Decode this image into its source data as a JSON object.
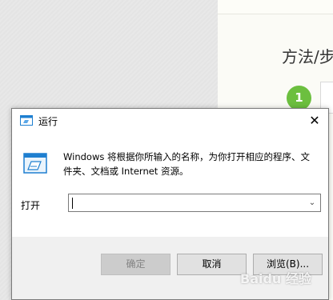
{
  "background_page": {
    "heading": "方法/步",
    "step_number": "1"
  },
  "dialog": {
    "title": "运行",
    "close_glyph": "✕",
    "description": "Windows 将根据你所输入的名称，为你打开相应的程序、文件夹、文档或 Internet 资源。",
    "open_label": "打开",
    "open_value": "",
    "buttons": {
      "ok": "确定",
      "cancel": "取消",
      "browse": "浏览(B)..."
    }
  },
  "watermark": "Baidu 经验",
  "colors": {
    "step_green": "#6cbf3f",
    "dialog_bg": "#f0f0f0",
    "icon_blue": "#1e7fd0"
  }
}
